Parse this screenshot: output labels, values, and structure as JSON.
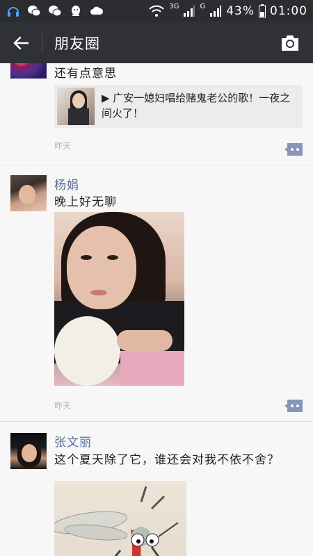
{
  "status_bar": {
    "network_3g": "3G",
    "network_g": "G",
    "battery": "43%",
    "time": "01:00",
    "icons": [
      "headset-icon",
      "wechat-icon",
      "wechat-icon",
      "qq-icon",
      "cloud-icon",
      "wifi-icon",
      "signal-icon",
      "signal-icon",
      "battery-icon"
    ]
  },
  "nav": {
    "title": "朋友圈",
    "back_icon": "back-arrow-icon",
    "camera_icon": "camera-icon"
  },
  "posts": [
    {
      "text": "还有点意思",
      "share_card": {
        "text": "▶ 广安一媳妇唱给赌鬼老公的歌！一夜之间火了！"
      },
      "time": "昨天"
    },
    {
      "name": "杨娟",
      "text": "晚上好无聊",
      "time": "昨天"
    },
    {
      "name": "张文丽",
      "text": "这个夏天除了它，谁还会对我不依不舍？"
    }
  ],
  "colors": {
    "nav_bg": "#2f3136",
    "status_bg": "#2b2d31",
    "name_link": "#576b95",
    "feed_bg": "#f7f7f7",
    "comment_icon": "#8796b6"
  }
}
